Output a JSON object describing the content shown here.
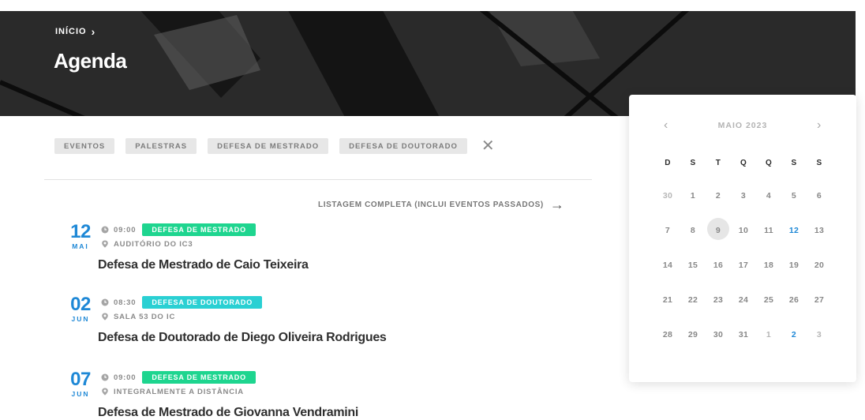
{
  "breadcrumb": {
    "label": "INÍCIO"
  },
  "page": {
    "title": "Agenda"
  },
  "filters": [
    {
      "label": "EVENTOS"
    },
    {
      "label": "PALESTRAS"
    },
    {
      "label": "DEFESA DE MESTRADO"
    },
    {
      "label": "DEFESA DE DOUTORADO"
    }
  ],
  "full_list_link": "LISTAGEM COMPLETA (INCLUI EVENTOS PASSADOS)",
  "colors": {
    "accent": "#1e88d6",
    "tag_mestrado": "#1ed58f",
    "tag_doutorado": "#2ad0d3"
  },
  "events": [
    {
      "day": "12",
      "month": "MAI",
      "time": "09:00",
      "tag": "DEFESA DE MESTRADO",
      "place": "AUDITÓRIO DO IC3",
      "title": "Defesa de Mestrado de Caio Teixeira"
    },
    {
      "day": "02",
      "month": "JUN",
      "time": "08:30",
      "tag": "DEFESA DE DOUTORADO",
      "place": "SALA 53 DO IC",
      "title": "Defesa de Doutorado de Diego Oliveira Rodrigues"
    },
    {
      "day": "07",
      "month": "JUN",
      "time": "09:00",
      "tag": "DEFESA DE MESTRADO",
      "place": "INTEGRALMENTE A DISTÂNCIA",
      "title": "Defesa de Mestrado de Giovanna Vendramini"
    }
  ],
  "calendar": {
    "month_label": "MAIO 2023",
    "weekdays": [
      "D",
      "S",
      "T",
      "Q",
      "Q",
      "S",
      "S"
    ],
    "weeks": [
      [
        "30",
        "1",
        "2",
        "3",
        "4",
        "5",
        "6"
      ],
      [
        "7",
        "8",
        "9",
        "10",
        "11",
        "12",
        "13"
      ],
      [
        "14",
        "15",
        "16",
        "17",
        "18",
        "19",
        "20"
      ],
      [
        "21",
        "22",
        "23",
        "24",
        "25",
        "26",
        "27"
      ],
      [
        "28",
        "29",
        "30",
        "31",
        "1",
        "2",
        "3"
      ]
    ]
  }
}
